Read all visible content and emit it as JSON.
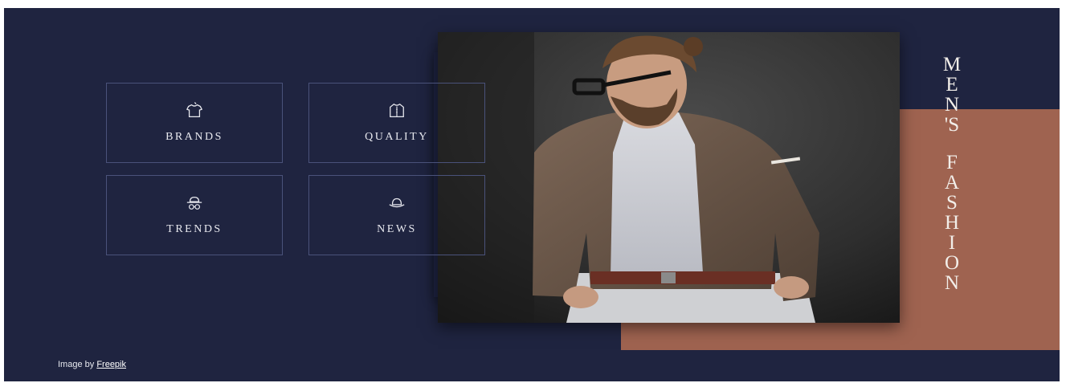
{
  "grid": {
    "cards": [
      {
        "label": "BRANDS",
        "icon": "tshirt-icon"
      },
      {
        "label": "QUALITY",
        "icon": "shirt-icon"
      },
      {
        "label": "TRENDS",
        "icon": "hat-glasses-icon"
      },
      {
        "label": "NEWS",
        "icon": "hat-icon"
      }
    ]
  },
  "vertical_title": {
    "word1": [
      "M",
      "E",
      "N",
      "'S"
    ],
    "word2": [
      "F",
      "A",
      "S",
      "H",
      "I",
      "O",
      "N"
    ]
  },
  "credit": {
    "prefix": "Image by",
    "link": "Freepik"
  },
  "colors": {
    "background": "#1f2440",
    "accent": "#9f6350",
    "border": "#4a527a",
    "text": "#e8e9ef"
  }
}
